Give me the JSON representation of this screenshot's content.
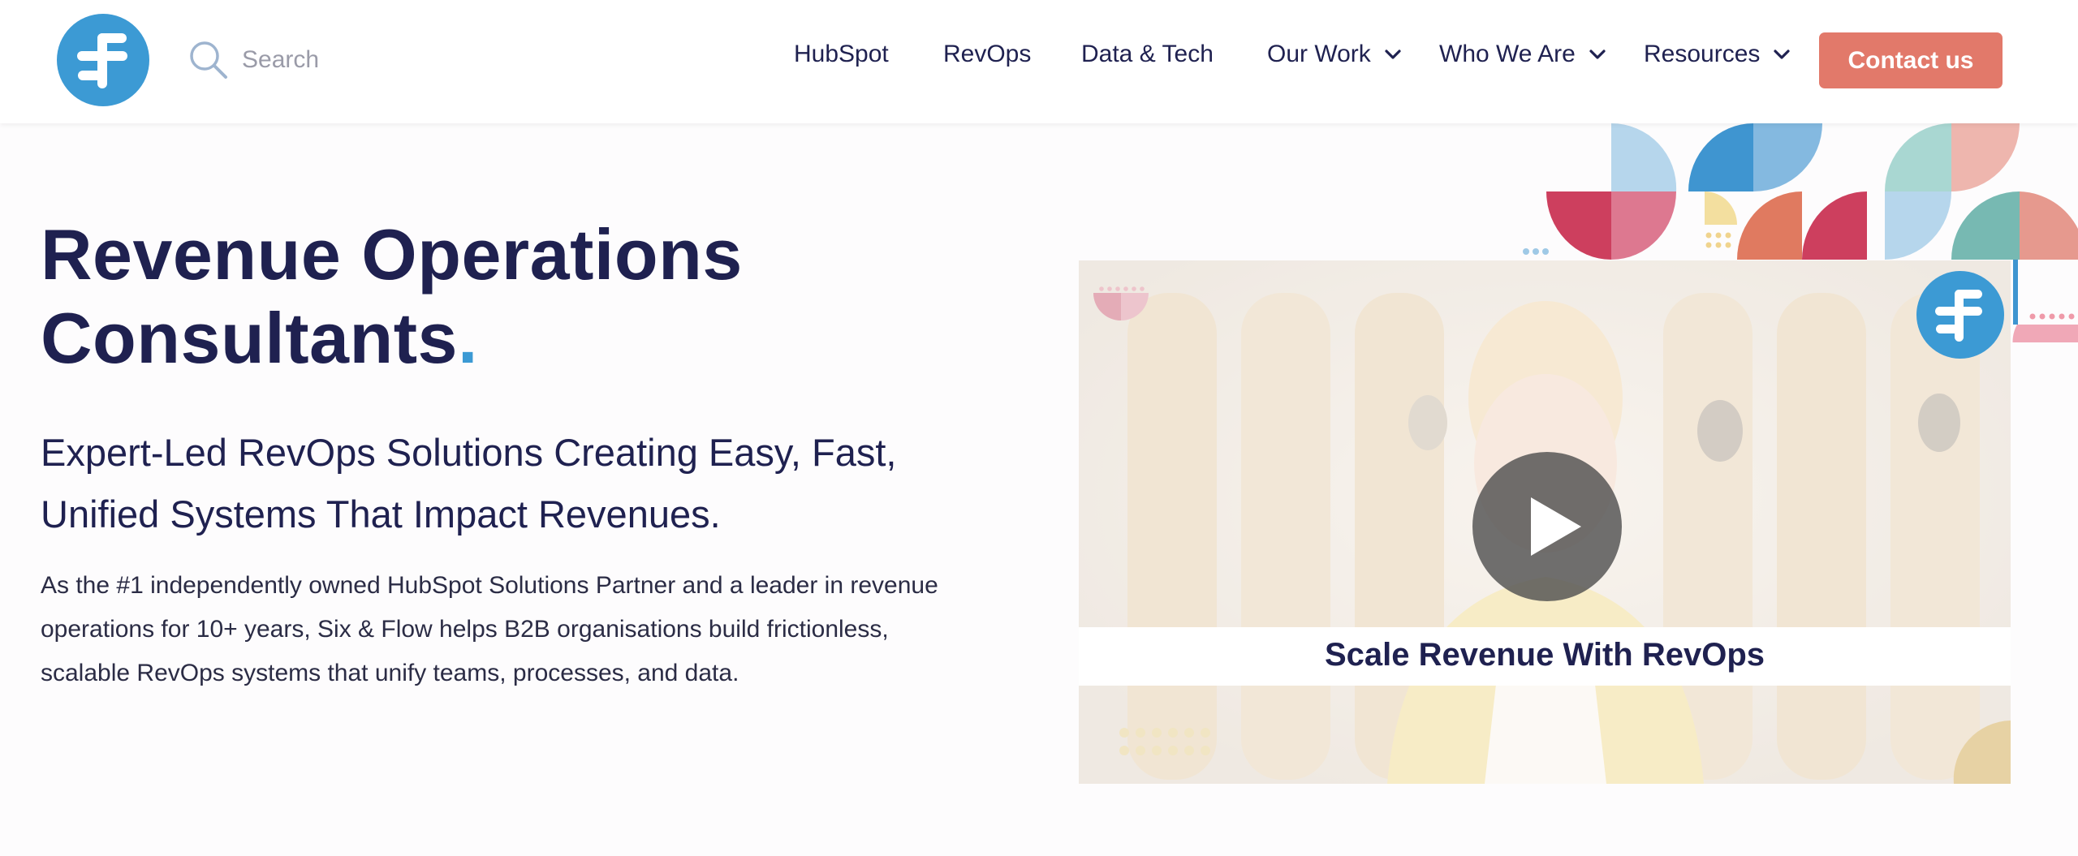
{
  "header": {
    "logo_name": "six-and-flow-logo",
    "search": {
      "placeholder": "Search",
      "icon": "search-icon"
    },
    "nav": [
      {
        "label": "HubSpot",
        "has_dropdown": false
      },
      {
        "label": "RevOps",
        "has_dropdown": false
      },
      {
        "label": "Data & Tech",
        "has_dropdown": false
      },
      {
        "label": "Our Work",
        "has_dropdown": true
      },
      {
        "label": "Who We Are",
        "has_dropdown": true
      },
      {
        "label": "Resources",
        "has_dropdown": true
      }
    ],
    "contact_label": "Contact us"
  },
  "hero": {
    "title_line1": "Revenue Operations",
    "title_line2": "Consultants",
    "title_dot": ".",
    "subtitle": "Expert-Led RevOps Solutions Creating Easy, Fast, Unified Systems That Impact Revenues.",
    "body": "As the #1 independently owned HubSpot Solutions Partner and a leader in revenue operations for 10+ years, Six & Flow helps B2B organisations build frictionless, scalable RevOps systems that unify teams, processes, and data."
  },
  "video": {
    "caption": "Scale Revenue With RevOps",
    "play_icon": "play-icon"
  },
  "colors": {
    "navy": "#1f2150",
    "brand_blue": "#3c9ad4",
    "contact_button": "#e2796a",
    "raspberry": "#cd3f5e",
    "teal": "#77b9b2",
    "salmon": "#e6998e",
    "light_blue": "#b3d7ec"
  }
}
